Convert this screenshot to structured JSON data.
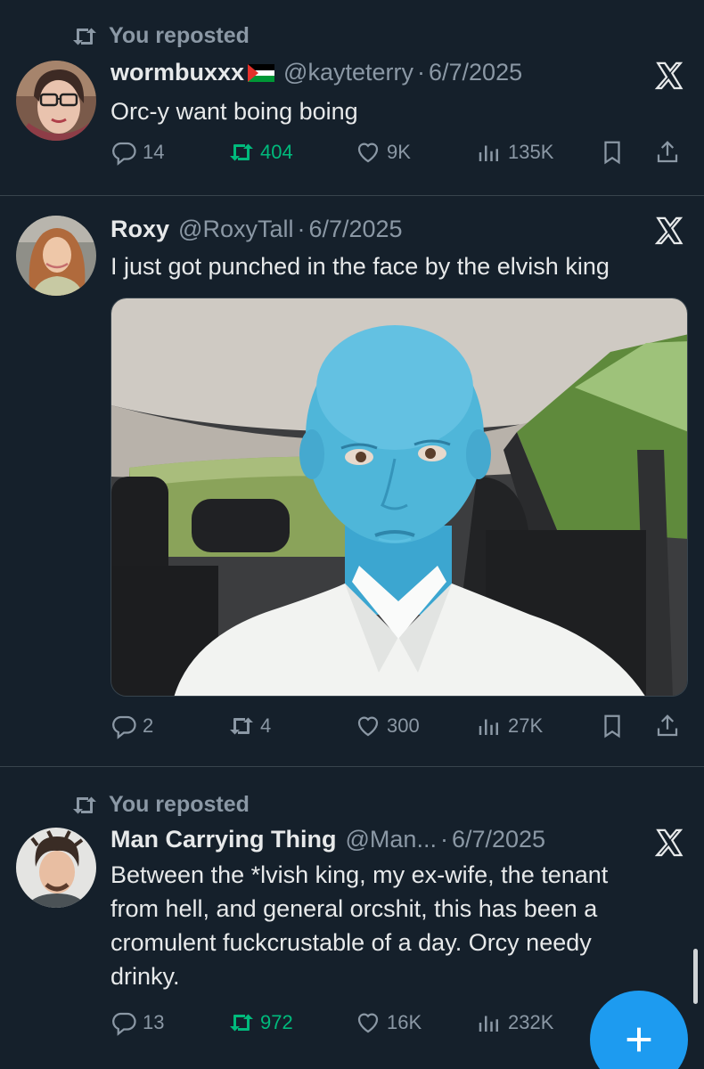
{
  "posts": [
    {
      "repost_label": "You reposted",
      "name": "wormbuxxx",
      "handle": "@kayteterry",
      "dot": "·",
      "date": "6/7/2025",
      "text": "Orc-y want boing boing",
      "replies": "14",
      "reposts": "404",
      "likes": "9K",
      "views": "135K",
      "reposted": true
    },
    {
      "name": "Roxy",
      "handle": "@RoxyTall",
      "dot": "·",
      "date": "6/7/2025",
      "text": "I just got punched in the face by the elvish king",
      "replies": "2",
      "reposts": "4",
      "likes": "300",
      "views": "27K",
      "reposted": false
    },
    {
      "repost_label": "You reposted",
      "name": "Man Carrying Thing",
      "handle": "@Man...",
      "dot": "·",
      "date": "6/7/2025",
      "text_lines": [
        "Between the *lvish king, my ex-wife, the tenant",
        "from hell, and general orcshit, this has been a",
        "cromulent fuckcrustable of a day. Orcy needy",
        "drinky."
      ],
      "replies": "13",
      "reposts": "972",
      "likes": "16K",
      "views": "232K",
      "reposted": true
    }
  ],
  "colors": {
    "background": "#15202b",
    "secondary_text": "#8b98a5",
    "repost_green": "#00ba7c",
    "accent_blue": "#1d9bf0",
    "primary_text": "#e7e9ea",
    "face_paint_blue": "#4fb6d9"
  },
  "icons": [
    "repost-icon",
    "x-logo-icon",
    "reply-icon",
    "like-icon",
    "views-icon",
    "bookmark-icon",
    "share-icon",
    "compose-plus-icon"
  ]
}
